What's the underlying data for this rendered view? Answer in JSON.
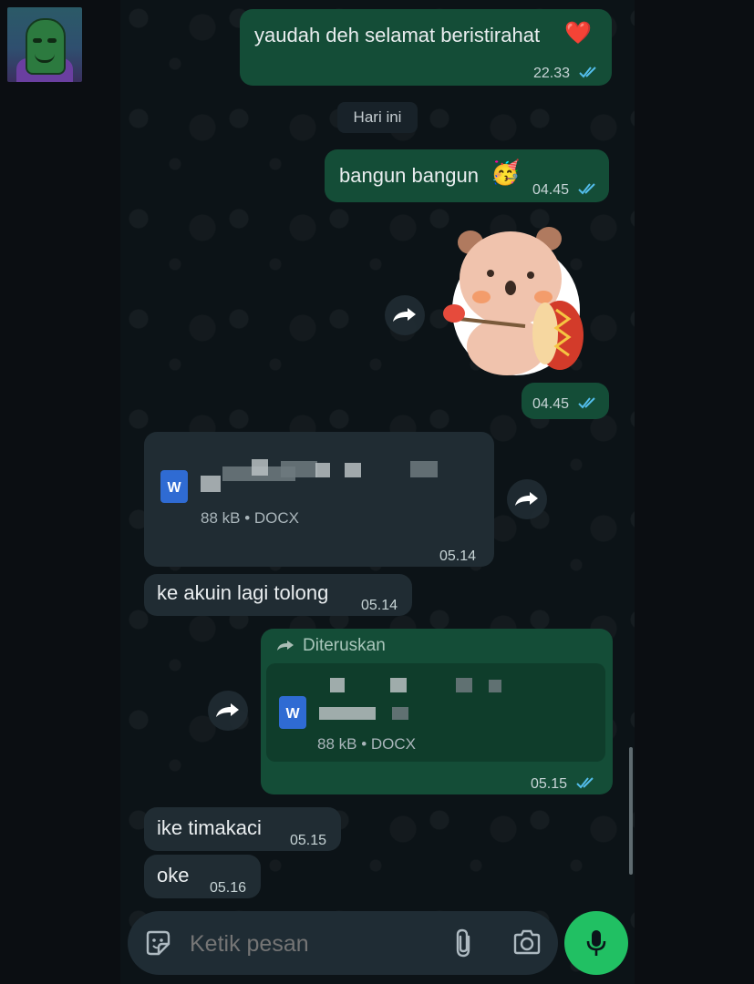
{
  "messages": {
    "m1": {
      "text": "yaudah deh selamat beristirahat",
      "emoji": "❤️",
      "time": "22.33"
    },
    "date_divider": "Hari ini",
    "m2": {
      "text": "bangun bangun",
      "emoji": "🥳",
      "time": "04.45"
    },
    "m3": {
      "time": "04.45",
      "sticker": "bear-drum-sticker"
    },
    "m4": {
      "doc_meta": "88 kB • DOCX",
      "time": "05.14",
      "doc_icon_letter": "W"
    },
    "m5": {
      "text": "ke akuin lagi tolong",
      "time": "05.14"
    },
    "m6": {
      "forwarded_label": "Diteruskan",
      "doc_meta": "88 kB • DOCX",
      "time": "05.15",
      "doc_icon_letter": "W"
    },
    "m7": {
      "text": "ike timakaci",
      "time": "05.15"
    },
    "m8": {
      "text": "oke",
      "time": "05.16"
    }
  },
  "composer": {
    "placeholder": "Ketik pesan"
  },
  "colors": {
    "outgoing": "#144d37",
    "incoming": "#202c33",
    "accent": "#21c063",
    "read_ticks": "#53bdeb"
  },
  "icons": [
    "double-check-icon",
    "forward-icon",
    "docx-icon",
    "sticker-icon",
    "attach-icon",
    "camera-icon",
    "mic-icon"
  ]
}
